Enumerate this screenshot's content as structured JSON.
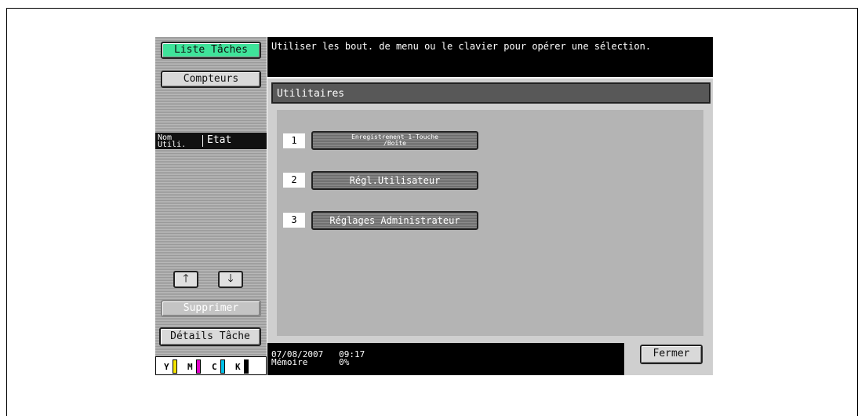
{
  "left": {
    "job_list_label": "Liste Tâches",
    "counters_label": "Compteurs",
    "col_user": "Nom\nUtili.",
    "col_status": "Etat",
    "up_icon": "arrow-up-icon",
    "down_icon": "arrow-down-icon",
    "delete_label": "Supprimer",
    "job_details_label": "Détails Tâche",
    "toner": [
      {
        "label": "Y",
        "color": "#f5e400"
      },
      {
        "label": "M",
        "color": "#e000c8"
      },
      {
        "label": "C",
        "color": "#00c0e8"
      },
      {
        "label": "K",
        "color": "#000000"
      }
    ]
  },
  "message": "Utiliser les bout. de menu ou le clavier pour opérer une sélection.",
  "main": {
    "title": "Utilitaires",
    "items": [
      {
        "num": "1",
        "label": "Enregistrement 1-Touche\n/Boîte"
      },
      {
        "num": "2",
        "label": "Régl.Utilisateur"
      },
      {
        "num": "3",
        "label": "Réglages Administrateur"
      }
    ],
    "close_label": "Fermer"
  },
  "status": {
    "date": "07/08/2007",
    "time": "09:17",
    "memory_label": "Mémoire",
    "memory_value": "0%"
  }
}
